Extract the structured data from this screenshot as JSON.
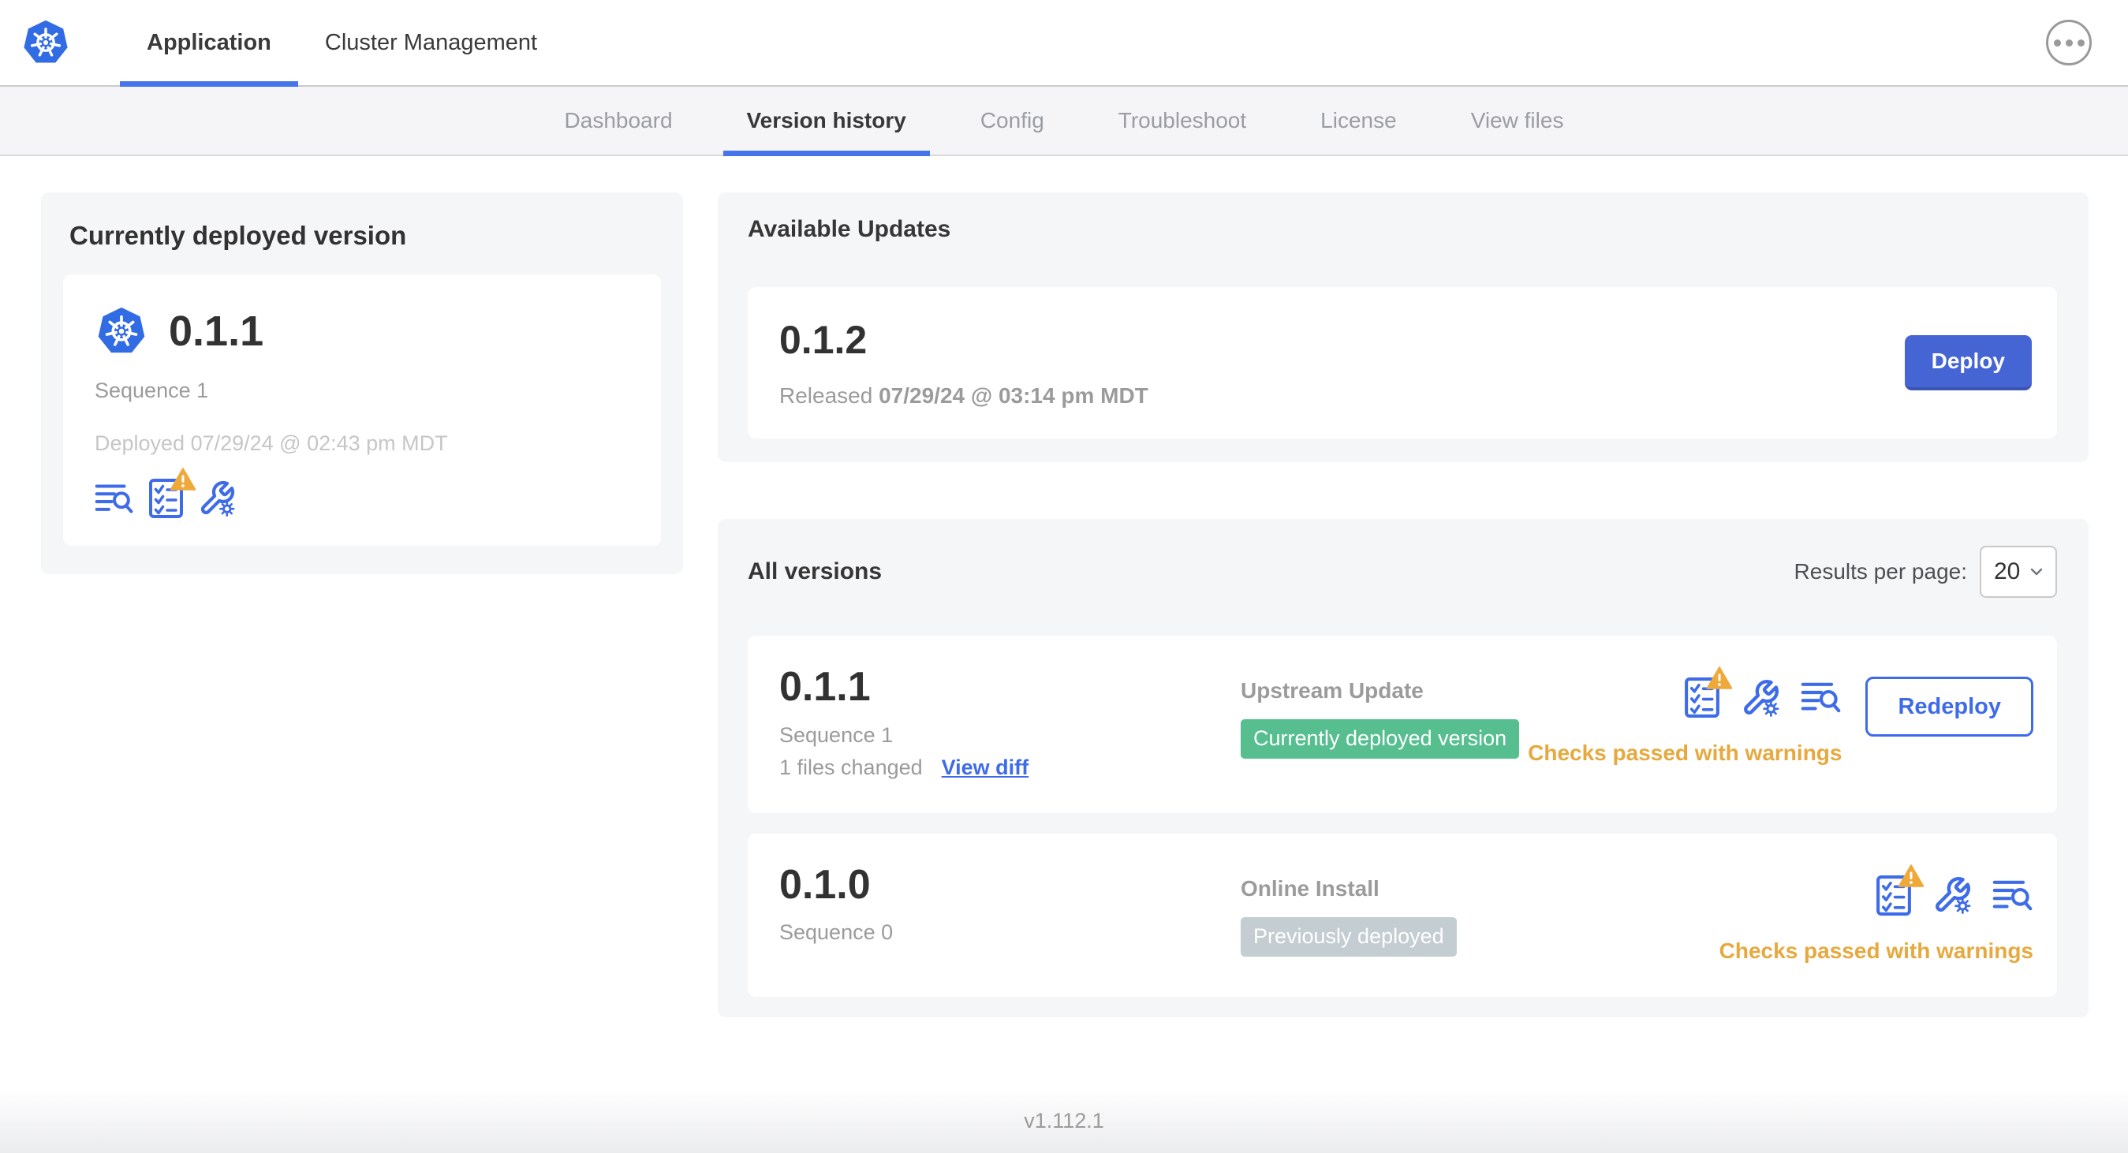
{
  "topbar": {
    "tabs": [
      {
        "label": "Application",
        "active": true
      },
      {
        "label": "Cluster Management",
        "active": false
      }
    ],
    "menu_icon": "ellipsis-menu-icon"
  },
  "subnav": {
    "tabs": [
      {
        "label": "Dashboard",
        "active": false
      },
      {
        "label": "Version history",
        "active": true
      },
      {
        "label": "Config",
        "active": false
      },
      {
        "label": "Troubleshoot",
        "active": false
      },
      {
        "label": "License",
        "active": false
      },
      {
        "label": "View files",
        "active": false
      }
    ]
  },
  "current": {
    "title": "Currently deployed version",
    "version": "0.1.1",
    "sequence": "Sequence 1",
    "deployed": "Deployed 07/29/24 @ 02:43 pm MDT",
    "icons": [
      "logs-icon",
      "preflight-checks-warning-icon",
      "config-wrench-icon"
    ]
  },
  "available": {
    "title": "Available Updates",
    "version": "0.1.2",
    "released_prefix": "Released",
    "released_date": "07/29/24 @ 03:14 pm MDT",
    "deploy_label": "Deploy"
  },
  "all_versions": {
    "title": "All versions",
    "results_label": "Results per page:",
    "results_value": "20",
    "rows": [
      {
        "version": "0.1.1",
        "sequence": "Sequence 1",
        "files_changed": "1 files changed",
        "view_diff_label": "View diff",
        "source": "Upstream Update",
        "badge": "Currently deployed version",
        "badge_type": "green",
        "status": "Checks passed with warnings",
        "action_label": "Redeploy",
        "icons": [
          "preflight-checks-warning-icon",
          "config-wrench-icon",
          "logs-icon"
        ]
      },
      {
        "version": "0.1.0",
        "sequence": "Sequence 0",
        "source": "Online Install",
        "badge": "Previously deployed",
        "badge_type": "gray",
        "status": "Checks passed with warnings",
        "icons": [
          "preflight-checks-warning-icon",
          "config-wrench-icon",
          "logs-icon"
        ]
      }
    ]
  },
  "footer": {
    "version": "v1.112.1"
  },
  "colors": {
    "k8s_blue": "#326ce5",
    "primary_button_blue": "#4565d4",
    "link_icon_blue": "#3e6be8",
    "active_underline_blue": "#4575e8",
    "warning_orange": "#e7a93e",
    "badge_green": "#57be90",
    "badge_gray": "#c3cdd2",
    "section_gray": "#f5f6f8"
  }
}
